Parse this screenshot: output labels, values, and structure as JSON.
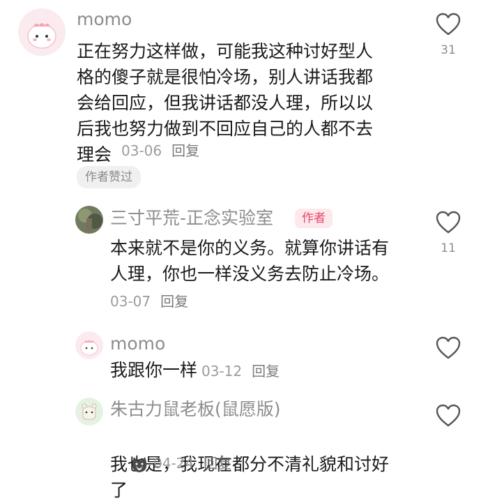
{
  "comment1": {
    "username": "momo",
    "text": "正在努力这样做，可能我这种讨好型人\n格的傻子就是很怕冷场，别人讲话我都\n会给回应，但我讲话都没人理，所以以\n后我也努力做到不回应自己的人都不去\n理会",
    "date": "03-06",
    "reply_label": "回复",
    "liked_by_author": "作者赞过",
    "like_count": "31"
  },
  "reply1": {
    "username": "三寸平荒-正念实验室",
    "author_tag": "作者",
    "text": "本来就不是你的义务。就算你讲话有\n人理，你也一样没义务去防止冷场。",
    "date": "03-07",
    "reply_label": "回复",
    "like_count": "11"
  },
  "reply2": {
    "username": "momo",
    "text": "我跟你一样",
    "date": "03-12",
    "reply_label": "回复"
  },
  "reply3": {
    "username": "朱古力鼠老板(鼠愿版)",
    "text": "我也是，我现在都分不清礼貌和讨好\n了",
    "date": "04-24",
    "reply_label": "回复"
  },
  "icons": {
    "like": "heart-outline-icon",
    "emoji": "cat-emoji-icon"
  }
}
